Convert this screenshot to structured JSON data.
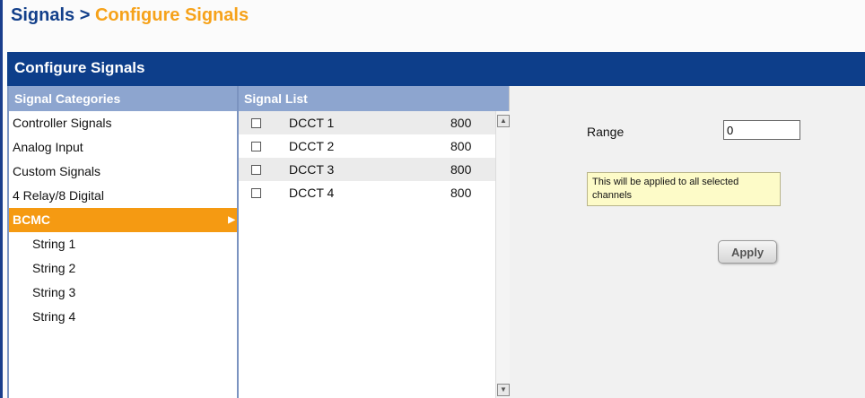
{
  "breadcrumb": {
    "root": "Signals",
    "separator": ">",
    "current": "Configure Signals"
  },
  "title_bar": {
    "title": "Configure Signals"
  },
  "categories": {
    "header": "Signal Categories",
    "items": [
      {
        "label": "Controller Signals"
      },
      {
        "label": "Analog Input"
      },
      {
        "label": "Custom Signals"
      },
      {
        "label": "4 Relay/8 Digital"
      },
      {
        "label": "BCMC",
        "active": true,
        "arrow_icon": "triangle-right-icon"
      },
      {
        "label": "String 1",
        "sub": true
      },
      {
        "label": "String 2",
        "sub": true
      },
      {
        "label": "String 3",
        "sub": true
      },
      {
        "label": "String 4",
        "sub": true
      }
    ]
  },
  "signal_list": {
    "header": "Signal List",
    "rows": [
      {
        "name": "DCCT 1",
        "value": "800",
        "checked": false
      },
      {
        "name": "DCCT 2",
        "value": "800",
        "checked": false
      },
      {
        "name": "DCCT 3",
        "value": "800",
        "checked": false
      },
      {
        "name": "DCCT 4",
        "value": "800",
        "checked": false
      }
    ],
    "scroll_up_icon": "arrow-up-icon",
    "scroll_down_icon": "arrow-down-icon"
  },
  "detail": {
    "range_label": "Range",
    "range_value": "0",
    "note": "This will be applied to all selected channels",
    "apply_label": "Apply"
  },
  "colors": {
    "brand_blue": "#0d3e8a",
    "header_blue": "#8da5cf",
    "accent_orange": "#f59a12",
    "breadcrumb_orange": "#f6a21a",
    "tooltip_yellow": "#fdfbc8"
  }
}
